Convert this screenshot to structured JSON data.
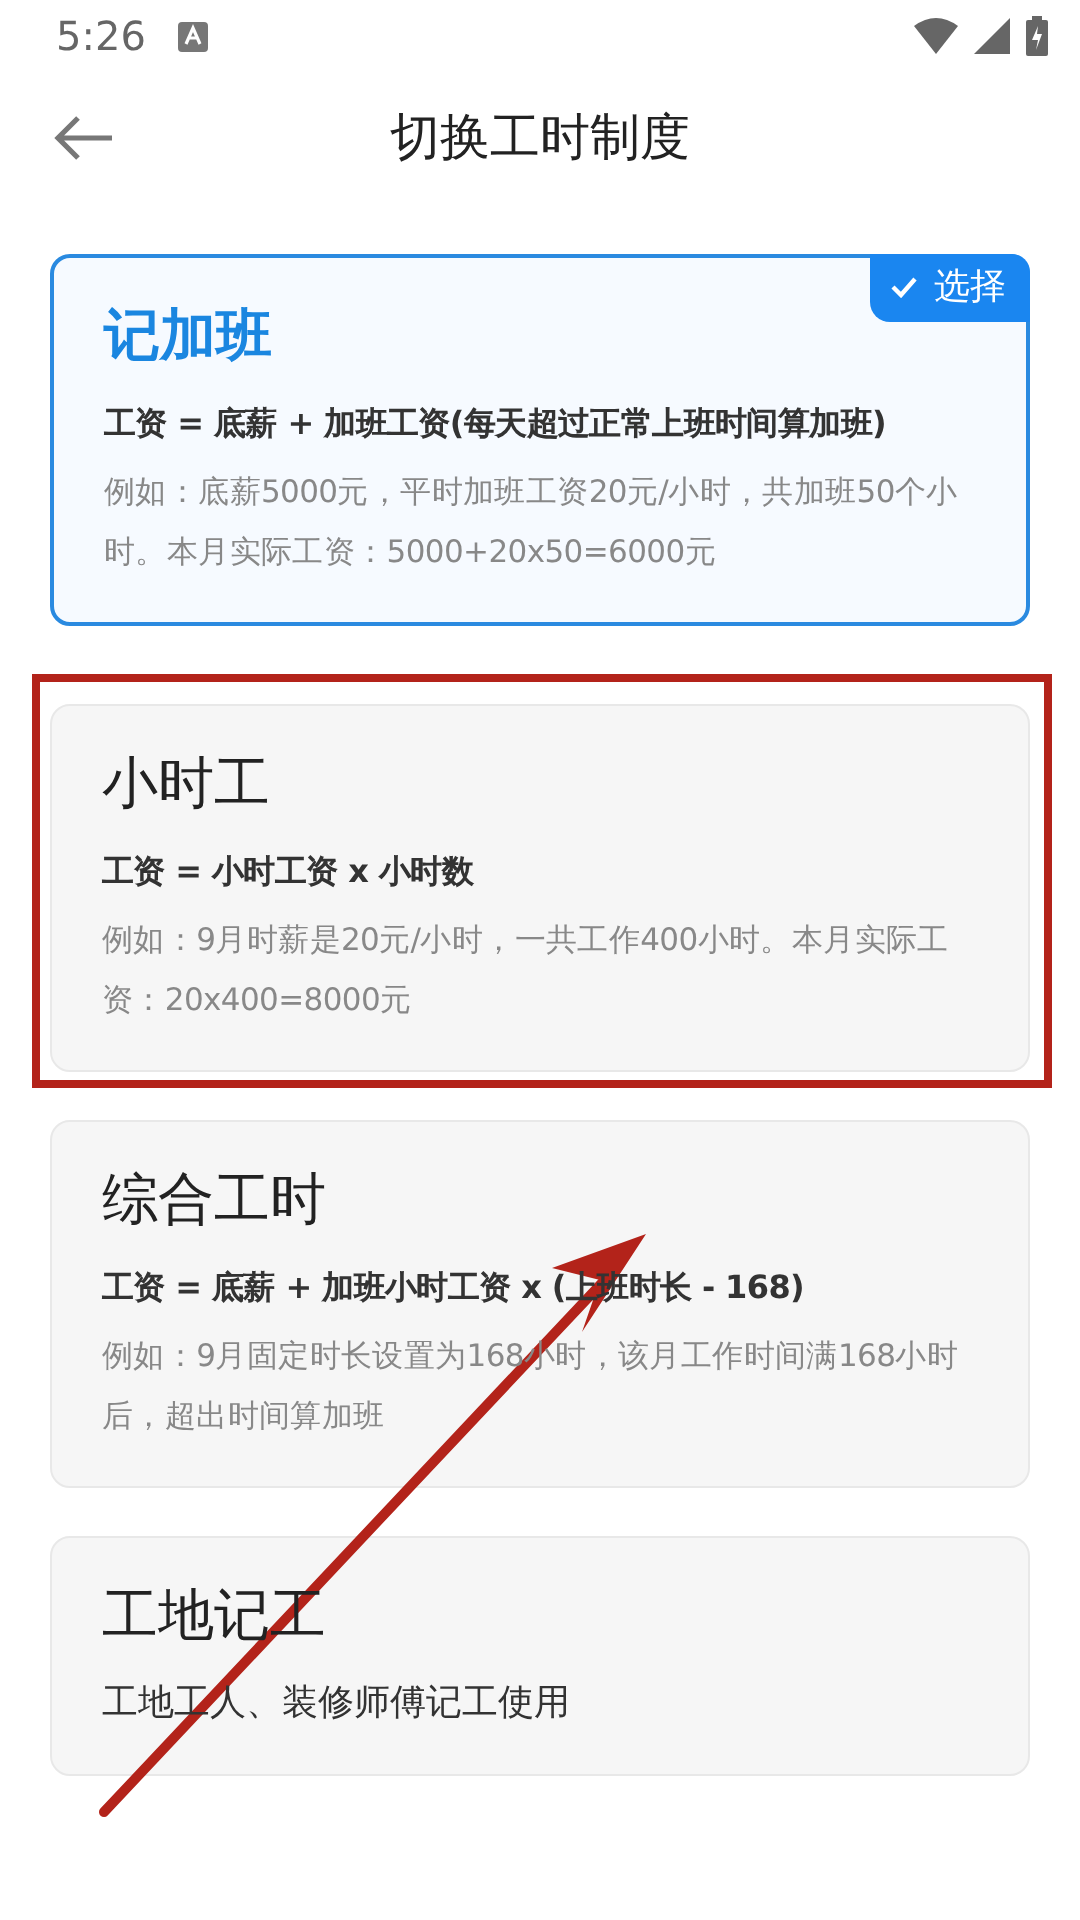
{
  "status_bar": {
    "time": "5:26"
  },
  "header": {
    "title": "切换工时制度"
  },
  "select_badge": "选择",
  "schemes": [
    {
      "title": "记加班",
      "formula": "工资 = 底薪 + 加班工资(每天超过正常上班时间算加班)",
      "example": "例如：底薪5000元，平时加班工资20元/小时，共加班50个小时。本月实际工资：5000+20x50=6000元",
      "selected": true,
      "highlighted": false
    },
    {
      "title": "小时工",
      "formula": "工资 = 小时工资 x 小时数",
      "example": "例如：9月时薪是20元/小时，一共工作400小时。本月实际工资：20x400=8000元",
      "selected": false,
      "highlighted": true
    },
    {
      "title": "综合工时",
      "formula": "工资 = 底薪 + 加班小时工资 x (上班时长 - 168)",
      "example": "例如：9月固定时长设置为168小时，该月工作时间满168小时后，超出时间算加班",
      "selected": false,
      "highlighted": false
    },
    {
      "title": "工地记工",
      "description": "工地工人、装修师傅记工使用",
      "selected": false,
      "highlighted": false
    }
  ]
}
